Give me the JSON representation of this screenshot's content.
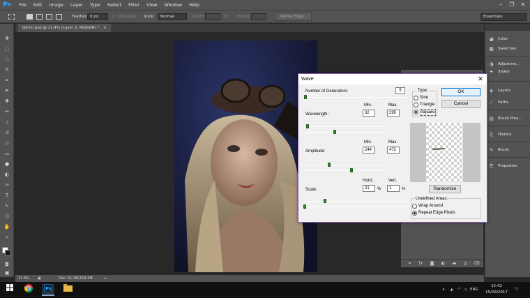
{
  "app": {
    "logo": "Ps",
    "menu": [
      "File",
      "Edit",
      "Image",
      "Layer",
      "Type",
      "Select",
      "Filter",
      "View",
      "Window",
      "Help"
    ]
  },
  "options_bar": {
    "feather_label": "Feather:",
    "feather_value": "0 px",
    "anti_alias_label": "Anti-alias",
    "style_label": "Style:",
    "style_value": "Normal",
    "width_label": "Width:",
    "height_label": "Height:",
    "refine_edge_label": "Refine Edge...",
    "workspace_value": "Essentials"
  },
  "document": {
    "tab_title": "Glitch.psd @ 11.4% (Layer 2, RGB/8#) *",
    "tab_close": "×"
  },
  "status_bar": {
    "zoom": "11.4%",
    "doc_info": "Doc: 51.3M/104.5M"
  },
  "right_panels": {
    "items": [
      {
        "label": "Color",
        "icon": "color-wheel-icon"
      },
      {
        "label": "Swatches",
        "icon": "grid-icon"
      },
      {
        "label": "Adjustme...",
        "icon": "adjustment-icon"
      },
      {
        "label": "Styles",
        "icon": "fx-icon"
      },
      {
        "label": "Layers",
        "icon": "layers-icon"
      },
      {
        "label": "Paths",
        "icon": "paths-icon"
      },
      {
        "label": "Brush Pres...",
        "icon": "brush-presets-icon"
      },
      {
        "label": "History",
        "icon": "history-icon"
      },
      {
        "label": "Brush",
        "icon": "brush-icon"
      },
      {
        "label": "Properties",
        "icon": "properties-icon"
      }
    ]
  },
  "wave_dialog": {
    "title": "Wave",
    "close": "✕",
    "generators_label": "Number of Generators:",
    "generators_value": "5",
    "wavelength_label": "Wavelength:",
    "wavelength_min": "32",
    "wavelength_max": "295",
    "amplitude_label": "Amplitude:",
    "amplitude_min": "244",
    "amplitude_max": "472",
    "min_label": "Min.",
    "max_label": "Max.",
    "scale_label": "Scale:",
    "horiz_label": "Horiz.",
    "vert_label": "Vert.",
    "scale_horiz": "21",
    "scale_vert": "1",
    "percent": "%",
    "type_label": "Type:",
    "types": [
      "Sine",
      "Triangle",
      "Square"
    ],
    "selected_type": "Square",
    "ok_label": "OK",
    "cancel_label": "Cancel",
    "randomize_label": "Randomize",
    "undefined_areas_label": "Undefined Areas:",
    "undefined_options": [
      "Wrap Around",
      "Repeat Edge Pixels"
    ],
    "selected_undefined": "Repeat Edge Pixels"
  },
  "taskbar": {
    "language": "ENG",
    "time": "15:42",
    "date": "15/09/2017"
  }
}
